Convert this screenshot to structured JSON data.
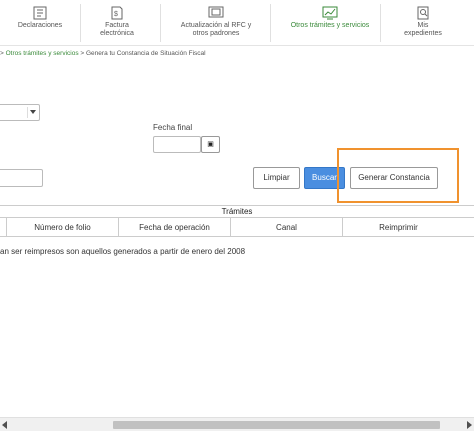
{
  "nav": {
    "items": [
      {
        "label": "Declaraciones",
        "icon": "declaraciones-icon"
      },
      {
        "label": "Factura electrónica",
        "icon": "factura-icon"
      },
      {
        "label": "Actualización al RFC y otros padrones",
        "icon": "actualizacion-rfc-icon"
      },
      {
        "label": "Otros trámites y servicios",
        "icon": "otros-tramites-icon",
        "active": true
      },
      {
        "label": "Mis expedientes",
        "icon": "expedientes-icon"
      }
    ],
    "active_color": "#3a8a3a"
  },
  "breadcrumb": {
    "prefix": "> ",
    "parent": "Otros trámites y servicios",
    "separator": " > ",
    "current": "Genera tu Constancia de Situación Fiscal"
  },
  "form": {
    "fecha_final_label": "Fecha final",
    "calendar_icon": "calendar-icon"
  },
  "buttons": {
    "limpiar": "Limpiar",
    "buscar": "Buscar",
    "generar": "Generar Constancia"
  },
  "table": {
    "title": "Trámites",
    "columns": [
      "Número de folio",
      "Fecha de operación",
      "Canal",
      "Reimprimir"
    ]
  },
  "note": "an ser reimpresos son aquellos generados a partir de enero del 2008",
  "colors": {
    "highlight": "#f0922e",
    "primary_button": "#4a8ee0"
  }
}
